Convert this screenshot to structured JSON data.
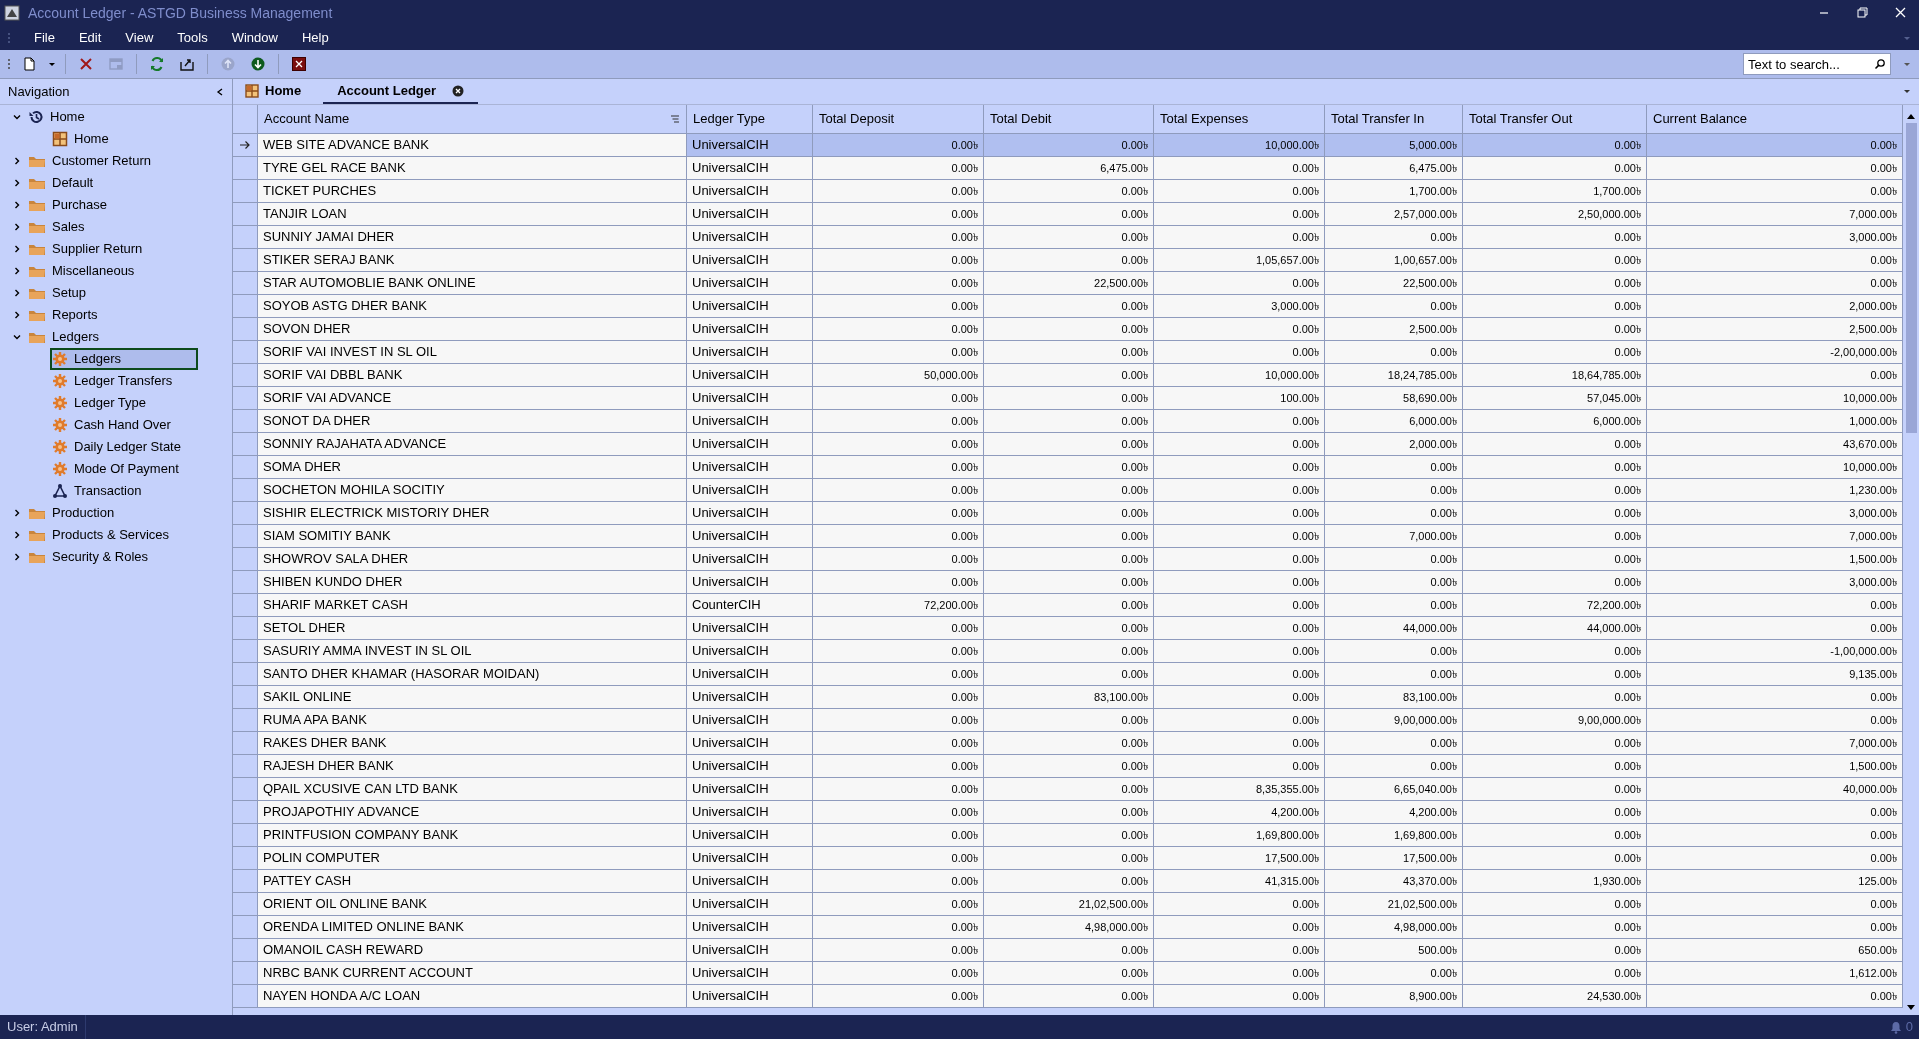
{
  "window": {
    "title": "Account Ledger - ASTGD Business Management"
  },
  "menu": [
    "File",
    "Edit",
    "View",
    "Tools",
    "Window",
    "Help"
  ],
  "toolbar": [
    {
      "kind": "new",
      "disabled": false
    },
    {
      "kind": "caret",
      "disabled": false
    },
    {
      "kind": "delete",
      "disabled": false
    },
    {
      "kind": "window",
      "disabled": true
    },
    {
      "kind": "refresh",
      "disabled": false
    },
    {
      "kind": "export",
      "disabled": false
    },
    {
      "kind": "up",
      "disabled": true
    },
    {
      "kind": "down",
      "disabled": false
    },
    {
      "kind": "close",
      "disabled": false
    }
  ],
  "search": {
    "placeholder": "Text to search..."
  },
  "navigation": {
    "title": "Navigation",
    "items": [
      {
        "label": "Home",
        "kind": "history",
        "expanded": true,
        "selected": false,
        "children": [
          {
            "label": "Home",
            "kind": "grid",
            "selected": false
          }
        ]
      },
      {
        "label": "Customer Return",
        "kind": "folder",
        "expanded": false,
        "selected": false
      },
      {
        "label": "Default",
        "kind": "folder",
        "expanded": false,
        "selected": false
      },
      {
        "label": "Purchase",
        "kind": "folder",
        "expanded": false,
        "selected": false
      },
      {
        "label": "Sales",
        "kind": "folder",
        "expanded": false,
        "selected": false
      },
      {
        "label": "Supplier Return",
        "kind": "folder",
        "expanded": false,
        "selected": false
      },
      {
        "label": "Miscellaneous",
        "kind": "folder",
        "expanded": false,
        "selected": false
      },
      {
        "label": "Setup",
        "kind": "folder",
        "expanded": false,
        "selected": false
      },
      {
        "label": "Reports",
        "kind": "folder",
        "expanded": false,
        "selected": false
      },
      {
        "label": "Ledgers",
        "kind": "folder",
        "expanded": true,
        "selected": false,
        "children": [
          {
            "label": "Ledgers",
            "kind": "gear",
            "selected": true
          },
          {
            "label": "Ledger Transfers",
            "kind": "gear",
            "selected": false
          },
          {
            "label": "Ledger Type",
            "kind": "gear",
            "selected": false
          },
          {
            "label": "Cash Hand Over",
            "kind": "gear",
            "selected": false
          },
          {
            "label": "Daily Ledger State",
            "kind": "gear",
            "selected": false
          },
          {
            "label": "Mode Of Payment",
            "kind": "gear",
            "selected": false
          },
          {
            "label": "Transaction",
            "kind": "network",
            "selected": false
          }
        ]
      },
      {
        "label": "Production",
        "kind": "folder",
        "expanded": false,
        "selected": false
      },
      {
        "label": "Products & Services",
        "kind": "folder",
        "expanded": false,
        "selected": false
      },
      {
        "label": "Security & Roles",
        "kind": "folder",
        "expanded": false,
        "selected": false
      }
    ]
  },
  "tabs": [
    {
      "label": "Home",
      "kind": "home",
      "selected": false
    },
    {
      "label": "Account Ledger",
      "kind": "document",
      "selected": true
    }
  ],
  "table": {
    "columns": [
      "Account Name",
      "Ledger Type",
      "Total Deposit",
      "Total Debit",
      "Total Expenses",
      "Total Transfer In",
      "Total Transfer Out",
      "Current Balance"
    ],
    "rows": [
      {
        "selected": true,
        "cells": [
          "WEB SITE ADVANCE BANK",
          "UniversalCIH",
          "0.00৳",
          "0.00৳",
          "10,000.00৳",
          "5,000.00৳",
          "0.00৳",
          "0.00৳"
        ]
      },
      {
        "selected": false,
        "cells": [
          "TYRE GEL RACE BANK",
          "UniversalCIH",
          "0.00৳",
          "6,475.00৳",
          "0.00৳",
          "6,475.00৳",
          "0.00৳",
          "0.00৳"
        ]
      },
      {
        "selected": false,
        "cells": [
          "TICKET PURCHES",
          "UniversalCIH",
          "0.00৳",
          "0.00৳",
          "0.00৳",
          "1,700.00৳",
          "1,700.00৳",
          "0.00৳"
        ]
      },
      {
        "selected": false,
        "cells": [
          "TANJIR LOAN",
          "UniversalCIH",
          "0.00৳",
          "0.00৳",
          "0.00৳",
          "2,57,000.00৳",
          "2,50,000.00৳",
          "7,000.00৳"
        ]
      },
      {
        "selected": false,
        "cells": [
          "SUNNIY JAMAI DHER",
          "UniversalCIH",
          "0.00৳",
          "0.00৳",
          "0.00৳",
          "0.00৳",
          "0.00৳",
          "3,000.00৳"
        ]
      },
      {
        "selected": false,
        "cells": [
          "STIKER SERAJ BANK",
          "UniversalCIH",
          "0.00৳",
          "0.00৳",
          "1,05,657.00৳",
          "1,00,657.00৳",
          "0.00৳",
          "0.00৳"
        ]
      },
      {
        "selected": false,
        "cells": [
          "STAR AUTOMOBLIE BANK ONLINE",
          "UniversalCIH",
          "0.00৳",
          "22,500.00৳",
          "0.00৳",
          "22,500.00৳",
          "0.00৳",
          "0.00৳"
        ]
      },
      {
        "selected": false,
        "cells": [
          "SOYOB ASTG DHER BANK",
          "UniversalCIH",
          "0.00৳",
          "0.00৳",
          "3,000.00৳",
          "0.00৳",
          "0.00৳",
          "2,000.00৳"
        ]
      },
      {
        "selected": false,
        "cells": [
          "SOVON DHER",
          "UniversalCIH",
          "0.00৳",
          "0.00৳",
          "0.00৳",
          "2,500.00৳",
          "0.00৳",
          "2,500.00৳"
        ]
      },
      {
        "selected": false,
        "cells": [
          "SORIF VAI INVEST IN SL OIL",
          "UniversalCIH",
          "0.00৳",
          "0.00৳",
          "0.00৳",
          "0.00৳",
          "0.00৳",
          "-2,00,000.00৳"
        ]
      },
      {
        "selected": false,
        "cells": [
          "SORIF VAI DBBL BANK",
          "UniversalCIH",
          "50,000.00৳",
          "0.00৳",
          "10,000.00৳",
          "18,24,785.00৳",
          "18,64,785.00৳",
          "0.00৳"
        ]
      },
      {
        "selected": false,
        "cells": [
          "SORIF VAI ADVANCE",
          "UniversalCIH",
          "0.00৳",
          "0.00৳",
          "100.00৳",
          "58,690.00৳",
          "57,045.00৳",
          "10,000.00৳"
        ]
      },
      {
        "selected": false,
        "cells": [
          "SONOT DA DHER",
          "UniversalCIH",
          "0.00৳",
          "0.00৳",
          "0.00৳",
          "6,000.00৳",
          "6,000.00৳",
          "1,000.00৳"
        ]
      },
      {
        "selected": false,
        "cells": [
          "SONNIY RAJAHATA ADVANCE",
          "UniversalCIH",
          "0.00৳",
          "0.00৳",
          "0.00৳",
          "2,000.00৳",
          "0.00৳",
          "43,670.00৳"
        ]
      },
      {
        "selected": false,
        "cells": [
          "SOMA DHER",
          "UniversalCIH",
          "0.00৳",
          "0.00৳",
          "0.00৳",
          "0.00৳",
          "0.00৳",
          "10,000.00৳"
        ]
      },
      {
        "selected": false,
        "cells": [
          "SOCHETON MOHILA SOCITIY",
          "UniversalCIH",
          "0.00৳",
          "0.00৳",
          "0.00৳",
          "0.00৳",
          "0.00৳",
          "1,230.00৳"
        ]
      },
      {
        "selected": false,
        "cells": [
          "SISHIR ELECTRICK MISTORIY DHER",
          "UniversalCIH",
          "0.00৳",
          "0.00৳",
          "0.00৳",
          "0.00৳",
          "0.00৳",
          "3,000.00৳"
        ]
      },
      {
        "selected": false,
        "cells": [
          "SIAM SOMITIY BANK",
          "UniversalCIH",
          "0.00৳",
          "0.00৳",
          "0.00৳",
          "7,000.00৳",
          "0.00৳",
          "7,000.00৳"
        ]
      },
      {
        "selected": false,
        "cells": [
          "SHOWROV SALA DHER",
          "UniversalCIH",
          "0.00৳",
          "0.00৳",
          "0.00৳",
          "0.00৳",
          "0.00৳",
          "1,500.00৳"
        ]
      },
      {
        "selected": false,
        "cells": [
          "SHIBEN KUNDO DHER",
          "UniversalCIH",
          "0.00৳",
          "0.00৳",
          "0.00৳",
          "0.00৳",
          "0.00৳",
          "3,000.00৳"
        ]
      },
      {
        "selected": false,
        "cells": [
          "SHARIF MARKET CASH",
          "CounterCIH",
          "72,200.00৳",
          "0.00৳",
          "0.00৳",
          "0.00৳",
          "72,200.00৳",
          "0.00৳"
        ]
      },
      {
        "selected": false,
        "cells": [
          "SETOL DHER",
          "UniversalCIH",
          "0.00৳",
          "0.00৳",
          "0.00৳",
          "44,000.00৳",
          "44,000.00৳",
          "0.00৳"
        ]
      },
      {
        "selected": false,
        "cells": [
          "SASURIY AMMA INVEST IN SL OIL",
          "UniversalCIH",
          "0.00৳",
          "0.00৳",
          "0.00৳",
          "0.00৳",
          "0.00৳",
          "-1,00,000.00৳"
        ]
      },
      {
        "selected": false,
        "cells": [
          "SANTO DHER KHAMAR (HASORAR MOIDAN)",
          "UniversalCIH",
          "0.00৳",
          "0.00৳",
          "0.00৳",
          "0.00৳",
          "0.00৳",
          "9,135.00৳"
        ]
      },
      {
        "selected": false,
        "cells": [
          "SAKIL ONLINE",
          "UniversalCIH",
          "0.00৳",
          "83,100.00৳",
          "0.00৳",
          "83,100.00৳",
          "0.00৳",
          "0.00৳"
        ]
      },
      {
        "selected": false,
        "cells": [
          "RUMA APA BANK",
          "UniversalCIH",
          "0.00৳",
          "0.00৳",
          "0.00৳",
          "9,00,000.00৳",
          "9,00,000.00৳",
          "0.00৳"
        ]
      },
      {
        "selected": false,
        "cells": [
          "RAKES DHER BANK",
          "UniversalCIH",
          "0.00৳",
          "0.00৳",
          "0.00৳",
          "0.00৳",
          "0.00৳",
          "7,000.00৳"
        ]
      },
      {
        "selected": false,
        "cells": [
          "RAJESH DHER BANK",
          "UniversalCIH",
          "0.00৳",
          "0.00৳",
          "0.00৳",
          "0.00৳",
          "0.00৳",
          "1,500.00৳"
        ]
      },
      {
        "selected": false,
        "cells": [
          "QPAIL XCUSIVE CAN LTD BANK",
          "UniversalCIH",
          "0.00৳",
          "0.00৳",
          "8,35,355.00৳",
          "6,65,040.00৳",
          "0.00৳",
          "40,000.00৳"
        ]
      },
      {
        "selected": false,
        "cells": [
          "PROJAPOTHIY ADVANCE",
          "UniversalCIH",
          "0.00৳",
          "0.00৳",
          "4,200.00৳",
          "4,200.00৳",
          "0.00৳",
          "0.00৳"
        ]
      },
      {
        "selected": false,
        "cells": [
          "PRINTFUSION COMPANY BANK",
          "UniversalCIH",
          "0.00৳",
          "0.00৳",
          "1,69,800.00৳",
          "1,69,800.00৳",
          "0.00৳",
          "0.00৳"
        ]
      },
      {
        "selected": false,
        "cells": [
          "POLIN COMPUTER",
          "UniversalCIH",
          "0.00৳",
          "0.00৳",
          "17,500.00৳",
          "17,500.00৳",
          "0.00৳",
          "0.00৳"
        ]
      },
      {
        "selected": false,
        "cells": [
          "PATTEY CASH",
          "UniversalCIH",
          "0.00৳",
          "0.00৳",
          "41,315.00৳",
          "43,370.00৳",
          "1,930.00৳",
          "125.00৳"
        ]
      },
      {
        "selected": false,
        "cells": [
          "ORIENT OIL ONLINE BANK",
          "UniversalCIH",
          "0.00৳",
          "21,02,500.00৳",
          "0.00৳",
          "21,02,500.00৳",
          "0.00৳",
          "0.00৳"
        ]
      },
      {
        "selected": false,
        "cells": [
          "ORENDA LIMITED ONLINE BANK",
          "UniversalCIH",
          "0.00৳",
          "4,98,000.00৳",
          "0.00৳",
          "4,98,000.00৳",
          "0.00৳",
          "0.00৳"
        ]
      },
      {
        "selected": false,
        "cells": [
          "OMANOIL CASH REWARD",
          "UniversalCIH",
          "0.00৳",
          "0.00৳",
          "0.00৳",
          "500.00৳",
          "0.00৳",
          "650.00৳"
        ]
      },
      {
        "selected": false,
        "cells": [
          "NRBC BANK CURRENT ACCOUNT",
          "UniversalCIH",
          "0.00৳",
          "0.00৳",
          "0.00৳",
          "0.00৳",
          "0.00৳",
          "1,612.00৳"
        ]
      },
      {
        "selected": false,
        "cells": [
          "NAYEN HONDA A/C LOAN",
          "UniversalCIH",
          "0.00৳",
          "0.00৳",
          "0.00৳",
          "8,900.00৳",
          "24,530.00৳",
          "0.00৳"
        ]
      }
    ]
  },
  "status_bar": {
    "user": "User: Admin",
    "notifications": "0"
  }
}
